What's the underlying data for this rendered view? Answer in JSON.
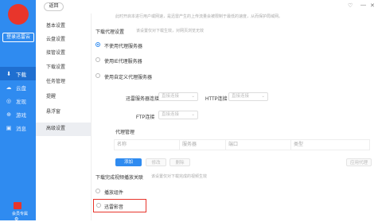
{
  "sidebar": {
    "login_label": "登录迅雷云",
    "nav": [
      {
        "label": "下载",
        "icon": "download-icon",
        "glyph": "⬇",
        "active": true
      },
      {
        "label": "云盘",
        "icon": "cloud-icon",
        "glyph": "☁",
        "active": false
      },
      {
        "label": "发现",
        "icon": "compass-icon",
        "glyph": "◎",
        "active": false
      },
      {
        "label": "游戏",
        "icon": "gamepad-icon",
        "glyph": "⊕",
        "active": false
      },
      {
        "label": "消息",
        "icon": "message-icon",
        "glyph": "▣",
        "active": false
      }
    ],
    "gift_label": "会员专属"
  },
  "topbar": {
    "back_label": "返回",
    "controls": [
      "♡",
      "—",
      "✕"
    ]
  },
  "menu": [
    "基本设置",
    "云盘设置",
    "接管设置",
    "下载设置",
    "任务管理",
    "提醒",
    "悬浮窗",
    "高级设置"
  ],
  "content": {
    "top_hint": "此时开启本进行用户或网速，是迅雷产生的上传流量会被限制于最低的速度，从而保护局域网。",
    "proxy": {
      "title": "下载代理设置",
      "hint": "该设置仅对下载生效，对网页浏览无效",
      "options": [
        "不使用代理服务器",
        "使用IE代理服务器",
        "使用自定义代理服务器"
      ],
      "field_labels": [
        "迅雷服务器连接",
        "HTTP连接",
        "FTP连接"
      ],
      "select_placeholder": "直接连接"
    },
    "proxy_manage": {
      "title": "代理管理",
      "columns": [
        "名称",
        "服务器",
        "端口",
        "类型"
      ],
      "buttons": {
        "add": "添加",
        "edit": "修改",
        "delete": "删除",
        "use": "应用代理"
      }
    },
    "video": {
      "title": "下载完成视频播放关联",
      "hint": "该设置仅对下载完成的视频生效",
      "options": [
        "播放组件",
        "迅雷影音"
      ]
    }
  },
  "colors": {
    "accent": "#2f8bf0",
    "highlight": "#e8352b"
  }
}
